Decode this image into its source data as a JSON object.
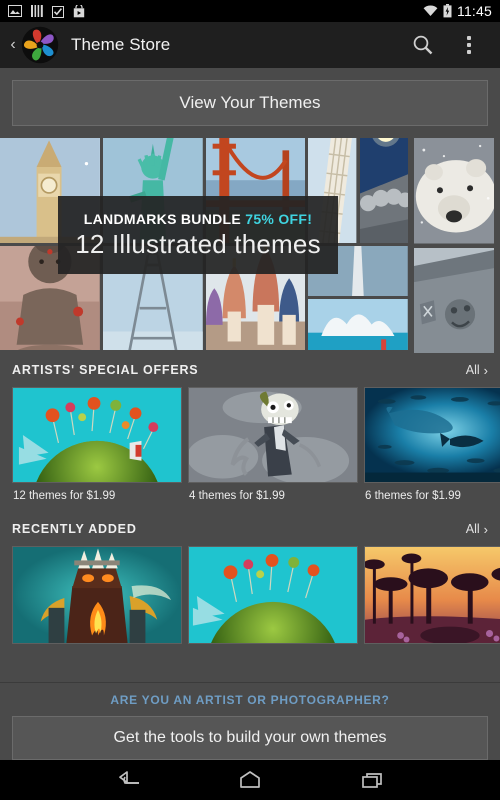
{
  "status_bar": {
    "icons": [
      "image-icon",
      "barcode-icon",
      "check-box-icon",
      "store-bag-icon"
    ],
    "wifi_icon": "wifi-icon",
    "battery_icon": "battery-charging-icon",
    "clock": "11:45"
  },
  "action_bar": {
    "back_icon": "chevron-left-icon",
    "logo_icon": "aperture-logo-icon",
    "title": "Theme Store",
    "search_icon": "search-icon",
    "overflow_icon": "overflow-menu-icon"
  },
  "view_themes": {
    "label": "View Your Themes"
  },
  "hero": {
    "headline": "LANDMARKS BUNDLE",
    "discount": "75% OFF!",
    "subhead": "12 Illustrated themes",
    "accent_color": "#3fd4e0",
    "tiles": [
      "big-ben",
      "statue-of-liberty",
      "golden-gate-bridge",
      "leaning-tower-of-pisa",
      "mount-rushmore",
      "great-wall-sunset",
      "buddha-statue",
      "eiffel-tower",
      "saint-basils-cathedral",
      "obelisk",
      "golden-statue",
      "sydney-opera-house"
    ],
    "side_tiles": [
      "polar-bear",
      "stone-carving"
    ]
  },
  "sections": [
    {
      "title": "ARTISTS' SPECIAL OFFERS",
      "all_label": "All",
      "all_icon": "chevron-right-icon",
      "items": [
        {
          "art": "green-planet",
          "caption": "12 themes for $1.99"
        },
        {
          "art": "zombie-suit",
          "caption": "4 themes for $1.99"
        },
        {
          "art": "underwater-shark",
          "caption": "6 themes for $1.99"
        }
      ]
    },
    {
      "title": "RECENTLY ADDED",
      "all_label": "All",
      "all_icon": "chevron-right-icon",
      "items": [
        {
          "art": "fire-golem",
          "caption": ""
        },
        {
          "art": "green-planet",
          "caption": ""
        },
        {
          "art": "savanna-sunset",
          "caption": ""
        }
      ]
    }
  ],
  "promo": {
    "title": "ARE YOU AN ARTIST OR PHOTOGRAPHER?",
    "title_color": "#6f9dc4",
    "button_label": "Get the tools to build your own themes"
  },
  "nav_bar": {
    "back_icon": "nav-back-icon",
    "home_icon": "nav-home-icon",
    "recents_icon": "nav-recents-icon"
  }
}
